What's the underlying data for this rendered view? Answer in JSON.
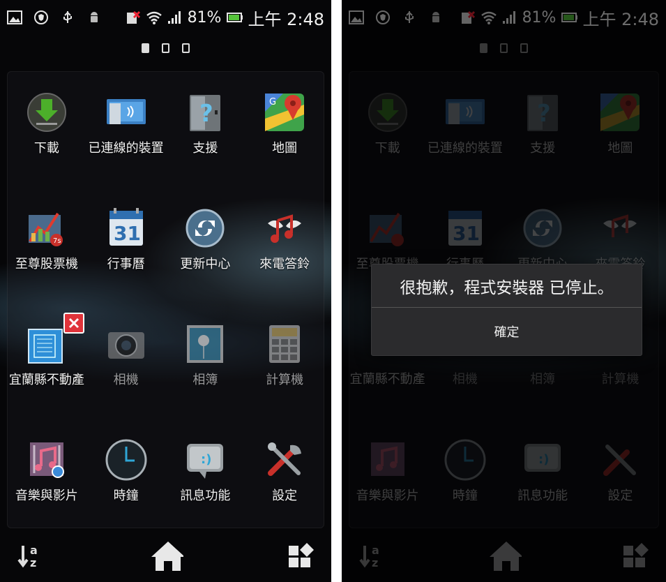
{
  "status_bar": {
    "battery": "81%",
    "time": "上午 2:48"
  },
  "apps": [
    {
      "label": "下載",
      "icon": "download-icon"
    },
    {
      "label": "已連線的裝置",
      "icon": "connected-devices-icon"
    },
    {
      "label": "支援",
      "icon": "support-icon"
    },
    {
      "label": "地圖",
      "icon": "maps-icon"
    },
    {
      "label": "至尊股票機",
      "icon": "stock-icon"
    },
    {
      "label": "行事曆",
      "icon": "calendar-icon"
    },
    {
      "label": "更新中心",
      "icon": "update-center-icon"
    },
    {
      "label": "來電答鈴",
      "icon": "ringtone-icon"
    },
    {
      "label": "宜蘭縣不動產",
      "icon": "real-estate-icon"
    },
    {
      "label": "相機",
      "icon": "camera-icon"
    },
    {
      "label": "相簿",
      "icon": "album-icon"
    },
    {
      "label": "計算機",
      "icon": "calculator-icon"
    },
    {
      "label": "音樂與影片",
      "icon": "music-video-icon"
    },
    {
      "label": "時鐘",
      "icon": "clock-icon"
    },
    {
      "label": "訊息功能",
      "icon": "messaging-icon"
    },
    {
      "label": "設定",
      "icon": "settings-icon"
    }
  ],
  "calendar_day": "31",
  "dialog": {
    "message": "很抱歉，程式安裝器 已停止。",
    "ok_label": "確定"
  },
  "dock": {
    "sort_icon_text": "a z"
  },
  "colors": {
    "background": "#060608",
    "dialog_bg": "#2b2b2d",
    "delete_badge": "#e0333a"
  }
}
